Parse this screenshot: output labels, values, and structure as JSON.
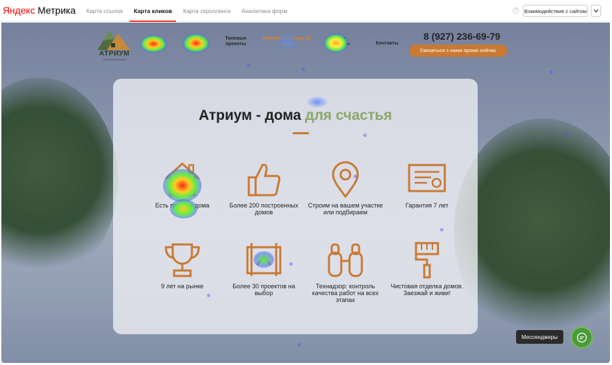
{
  "app": {
    "logo_brand": "Яндекс",
    "logo_product": "Метрика"
  },
  "tabs": [
    {
      "label": "Карта ссылок",
      "active": false
    },
    {
      "label": "Карта кликов",
      "active": true
    },
    {
      "label": "Карта скроллинга",
      "active": false
    },
    {
      "label": "Аналитика форм",
      "active": false
    }
  ],
  "toolbar": {
    "interaction_label": "Взаимодействие с сайтом",
    "accent_color": "#ee3322"
  },
  "site": {
    "logo_text": "АТРИУМ",
    "logo_subtext": "строительная компания",
    "nav": [
      {
        "label": "Ипотека"
      },
      {
        "label": "Объекты"
      },
      {
        "label": "Типовые проекты"
      },
      {
        "label": "Меняем квартиру на дом"
      },
      {
        "label": "Наши клиенты"
      },
      {
        "label": "Контакты"
      }
    ],
    "phone": "8 (927) 236-69-79",
    "callback_label": "Связаться с нами прямо сейчас",
    "title_main": "Атриум - дома ",
    "title_accent": "для счастья",
    "accent_color": "#c87a33",
    "green_color": "#8aa86a",
    "features": [
      {
        "icon": "house-icon",
        "label": "Есть готовые дома"
      },
      {
        "icon": "thumbs-up-icon",
        "label": "Более 200 построенных домов"
      },
      {
        "icon": "map-pin-icon",
        "label": "Строим на вашем участке или подбираем"
      },
      {
        "icon": "certificate-icon",
        "label": "Гарантия 7 лет"
      },
      {
        "icon": "trophy-icon",
        "label": "9 лет на рынке"
      },
      {
        "icon": "blueprint-icon",
        "label": "Более 30 проектов на выбор"
      },
      {
        "icon": "binoculars-icon",
        "label": "Технадзор: контроль качества работ на всех этапах"
      },
      {
        "icon": "paint-brush-icon",
        "label": "Чистовая отделка домов. Заезжай и живи!"
      }
    ]
  },
  "messenger": {
    "label": "Мессенджеры"
  }
}
